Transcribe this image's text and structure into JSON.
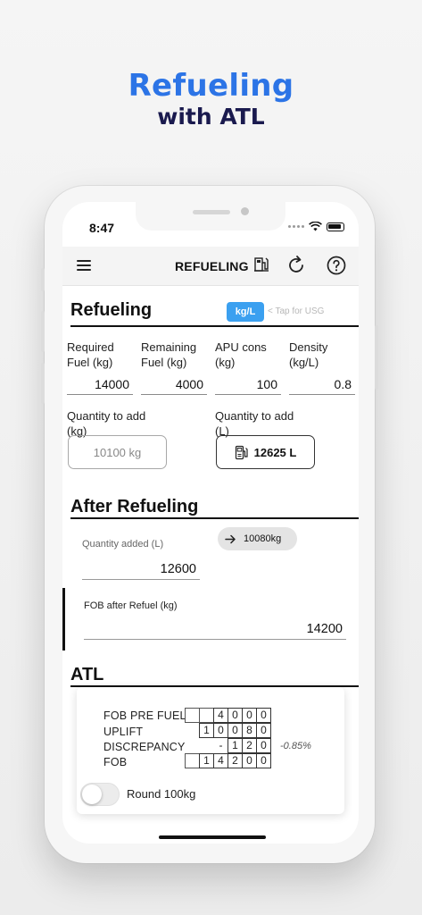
{
  "promo": {
    "title": "Refueling",
    "subtitle": "with ATL"
  },
  "status_bar": {
    "time": "8:47"
  },
  "navbar": {
    "title": "REFUELING",
    "icons": [
      "menu-icon",
      "fuel-pump-icon",
      "refresh-icon",
      "help-icon"
    ]
  },
  "refueling": {
    "title": "Refueling",
    "unit_toggle": "kg/L",
    "unit_hint": "< Tap for USG",
    "fields": [
      {
        "label_l1": "Required",
        "label_l2": "Fuel (kg)",
        "value": "14000"
      },
      {
        "label_l1": "Remaining",
        "label_l2": "Fuel (kg)",
        "value": "4000"
      },
      {
        "label_l1": "APU cons",
        "label_l2": "(kg)",
        "value": "100"
      },
      {
        "label_l1": "Density",
        "label_l2": "(kg/L)",
        "value": "0.8"
      }
    ],
    "qty_kg": {
      "label_l1": "Quantity to add",
      "label_l2": "(kg)",
      "value": "10100 kg"
    },
    "qty_l": {
      "label_l1": "Quantity to add",
      "label_l2": "(L)",
      "value": "12625 L"
    }
  },
  "after_refueling": {
    "title": "After Refueling",
    "qty_added_label": "Quantity added (L)",
    "qty_added_value": "12600",
    "converted_chip": "10080kg",
    "fob_label": "FOB after Refuel (kg)",
    "fob_value": "14200"
  },
  "atl": {
    "title": "ATL",
    "rows": [
      {
        "label": "FOB PRE FUEL",
        "digits": [
          "",
          "",
          "4",
          "0",
          "0",
          "0"
        ]
      },
      {
        "label": "UPLIFT",
        "digits": [
          "",
          "1",
          "0",
          "0",
          "8",
          "0"
        ]
      },
      {
        "label": "DISCREPANCY",
        "digits": [
          "",
          "",
          "-",
          "1",
          "2",
          "0"
        ],
        "percent": "-0.85%"
      },
      {
        "label": "FOB",
        "digits": [
          "",
          "1",
          "4",
          "2",
          "0",
          "0"
        ]
      }
    ],
    "round_label": "Round 100kg",
    "round_enabled": false
  },
  "colors": {
    "accent_blue": "#2c74e6",
    "navy": "#1a1a4e",
    "badge_blue": "#3ba0f0"
  }
}
